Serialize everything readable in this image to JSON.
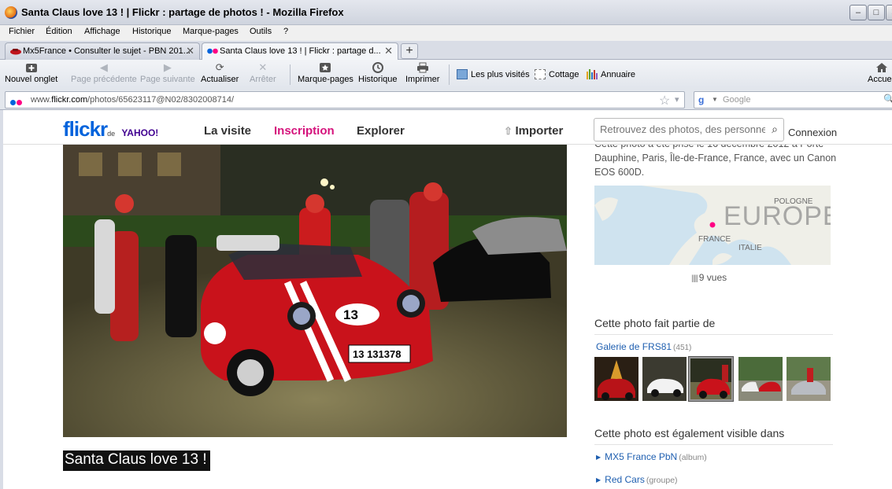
{
  "window": {
    "title": "Santa Claus love 13 ! | Flickr : partage de photos ! - Mozilla Firefox",
    "min": "–",
    "max": "□",
    "close": "✕"
  },
  "menu": [
    "Fichier",
    "Édition",
    "Affichage",
    "Historique",
    "Marque-pages",
    "Outils",
    "?"
  ],
  "tabs": [
    {
      "label": "Mx5France • Consulter le sujet - PBN 201...",
      "close": "✕"
    },
    {
      "label": "Santa Claus love 13 ! | Flickr : partage d...",
      "close": "✕"
    }
  ],
  "new_tab": "+",
  "toolbar": {
    "new_tab": "Nouvel onglet",
    "back": "Page précédente",
    "forward": "Page suivante",
    "reload": "Actualiser",
    "stop": "Arrêter",
    "bookmarks": "Marque-pages",
    "history": "Historique",
    "print": "Imprimer",
    "most_visited": "Les plus visités",
    "cottage": "Cottage",
    "annuaire": "Annuaire",
    "home": "Accueil"
  },
  "address": {
    "prefix": "www.",
    "domain": "flickr.com",
    "path": "/photos/65623117@N02/8302008714/"
  },
  "search_engine": {
    "placeholder": "Google"
  },
  "flickr": {
    "logo_main": "flickr",
    "logo_de": "de",
    "logo_yahoo": "YAHOO!",
    "nav": {
      "tour": "La visite",
      "signup": "Inscription",
      "explore": "Explorer",
      "upload": "Importer"
    },
    "search_placeholder": "Retrouvez des photos, des personnes",
    "signin": "Connexion"
  },
  "photo": {
    "title": "Santa Claus love 13 !",
    "plate": "13 131378",
    "number": "13"
  },
  "sidebar": {
    "description": "Cette photo a été prise le 16 décembre 2012 à Porte Dauphine, Paris, Île-de-France, France, avec un Canon EOS 600D.",
    "map_labels": {
      "europe": "EUROPE",
      "pologne": "POLOGNE",
      "france": "FRANCE",
      "italie": "ITALIE"
    },
    "views": "9 vues",
    "part_of_heading": "Cette photo fait partie de",
    "gallery_link": "Galerie de FRS81",
    "gallery_count": "(451)",
    "also_visible_heading": "Cette photo est également visible dans",
    "sets": [
      {
        "label": "MX5 France PbN",
        "kind": "(album)"
      },
      {
        "label": "Red Cars",
        "kind": "(groupe)"
      }
    ]
  },
  "colors": {
    "flickr_blue": "#0063dc",
    "flickr_pink": "#ff0084",
    "link": "#1f5fb0"
  }
}
